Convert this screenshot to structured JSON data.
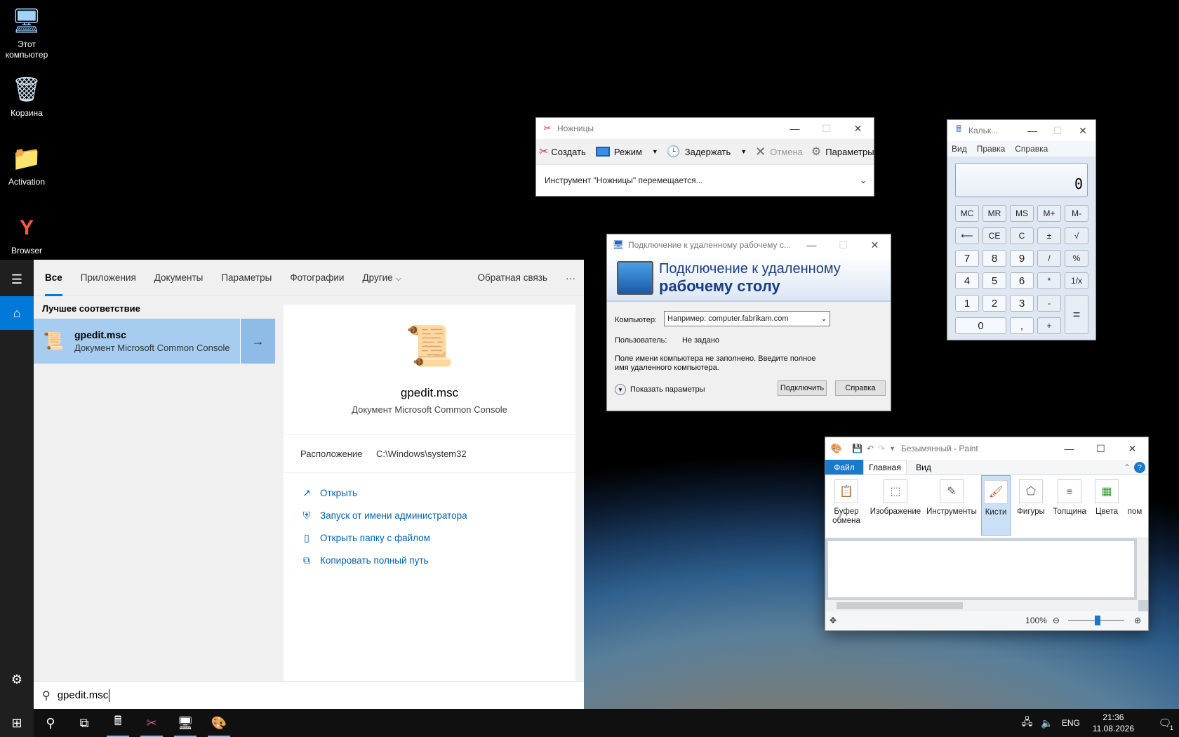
{
  "desktop": {
    "icons": [
      {
        "label": "Этот компьютер",
        "icon": "computer-icon"
      },
      {
        "label": "Корзина",
        "icon": "recycle-bin-icon"
      },
      {
        "label": "Activation",
        "icon": "folder-icon"
      },
      {
        "label": "Browser",
        "icon": "yandex-browser-icon"
      }
    ]
  },
  "start_menu": {
    "tabs": [
      "Все",
      "Приложения",
      "Документы",
      "Параметры",
      "Фотографии",
      "Другие"
    ],
    "feedback": "Обратная связь",
    "more": "···",
    "best_match_heading": "Лучшее соответствие",
    "result": {
      "title": "gpedit.msc",
      "subtitle": "Документ Microsoft Common Console"
    },
    "preview": {
      "title": "gpedit.msc",
      "subtitle": "Документ Microsoft Common Console",
      "location_label": "Расположение",
      "location_value": "C:\\Windows\\system32",
      "actions": [
        "Открыть",
        "Запуск от имени администратора",
        "Открыть папку с файлом",
        "Копировать полный путь"
      ]
    },
    "search_value": "gpedit.msc"
  },
  "snipping": {
    "title": "Ножницы",
    "toolbar": {
      "create": "Создать",
      "mode": "Режим",
      "delay": "Задержать",
      "cancel": "Отмена",
      "options": "Параметры"
    },
    "message": "Инструмент \"Ножницы\" перемещается..."
  },
  "rdp": {
    "title": "Подключение к удаленному рабочему с...",
    "banner_line1": "Подключение к удаленному",
    "banner_line2": "рабочему столу",
    "computer_label": "Компьютер:",
    "computer_placeholder": "Например: computer.fabrikam.com",
    "user_label": "Пользователь:",
    "user_value": "Не задано",
    "warning": "Поле имени компьютера не заполнено. Введите полное имя удаленного компьютера.",
    "show_options": "Показать параметры",
    "connect": "Подключить",
    "help": "Справка"
  },
  "calculator": {
    "title": "Кальк...",
    "menu": [
      "Вид",
      "Правка",
      "Справка"
    ],
    "display": "0",
    "keys": {
      "mc": "MC",
      "mr": "MR",
      "ms": "MS",
      "mplus": "M+",
      "mminus": "M-",
      "back": "⟵",
      "ce": "CE",
      "c": "C",
      "pm": "±",
      "sqrt": "√",
      "k7": "7",
      "k8": "8",
      "k9": "9",
      "div": "/",
      "pct": "%",
      "k4": "4",
      "k5": "5",
      "k6": "6",
      "mul": "*",
      "inv": "1/x",
      "k1": "1",
      "k2": "2",
      "k3": "3",
      "sub": "-",
      "eq": "=",
      "k0": "0",
      "dot": ",",
      "add": "+"
    }
  },
  "paint": {
    "title": "Безымянный - Paint",
    "tabs": [
      "Файл",
      "Главная",
      "Вид"
    ],
    "groups": [
      "Буфер обмена",
      "Изображение",
      "Инструменты",
      "Кисти",
      "Фигуры",
      "Толщина",
      "Цвета",
      "пом"
    ],
    "zoom": "100%"
  },
  "taskbar": {
    "lang": "ENG",
    "time": "21:36",
    "date": "11.08.2026",
    "notif_count": "1"
  }
}
